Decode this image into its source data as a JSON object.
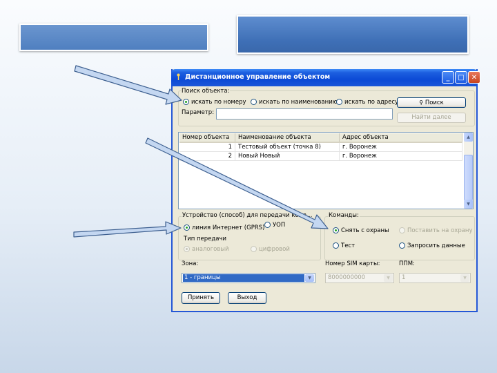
{
  "window": {
    "title": "Дистанционное управление объектом",
    "controls": {
      "minimize": "_",
      "maximize": "□",
      "close": "✕"
    },
    "icons": {
      "app": "antenna-icon"
    }
  },
  "search_group": {
    "caption": "Поиск объекта:",
    "options": [
      "искать по номеру",
      "искать по наименованию",
      "искать по адресу"
    ],
    "selected_index": 0,
    "param_label": "Параметр:",
    "param_value": "",
    "search_button": "Поиск",
    "find_next_button": "Найти далее"
  },
  "table": {
    "columns": [
      "Номер объекта",
      "Наименование объекта",
      "Адрес объекта"
    ],
    "rows": [
      {
        "num": "1",
        "name": "Тестовый объект (точка 8)",
        "addr": "г. Воронеж"
      },
      {
        "num": "2",
        "name": "Новый Новый",
        "addr": "г. Воронеж"
      }
    ]
  },
  "device_group": {
    "caption": "Устройство (способ) для передачи кома...",
    "options": [
      "линия Интернет (GPRS)",
      "УОП"
    ],
    "selected_index": 0,
    "transmission_caption": "Тип передачи",
    "transmission_options": [
      "аналоговый",
      "цифровой"
    ]
  },
  "commands_group": {
    "caption": "Команды:",
    "options": [
      "Снять с охраны",
      "Поставить на охрану",
      "Тест",
      "Запросить данные"
    ],
    "selected_index": 0
  },
  "zone": {
    "label": "Зона:",
    "value": "1 - границы"
  },
  "sim": {
    "label": "Номер SIM карты:",
    "value": "8000000000"
  },
  "ppm": {
    "label": "ППМ:",
    "value": "1"
  },
  "buttons": {
    "apply": "Принять",
    "exit": "Выход"
  },
  "colors": {
    "banner_light": "#5b8ccf",
    "banner_dark": "#3c6cb4",
    "arrow_fill": "#c4d7f1",
    "arrow_stroke": "#3d5f8f",
    "titlebar": "#0c4ad6"
  }
}
